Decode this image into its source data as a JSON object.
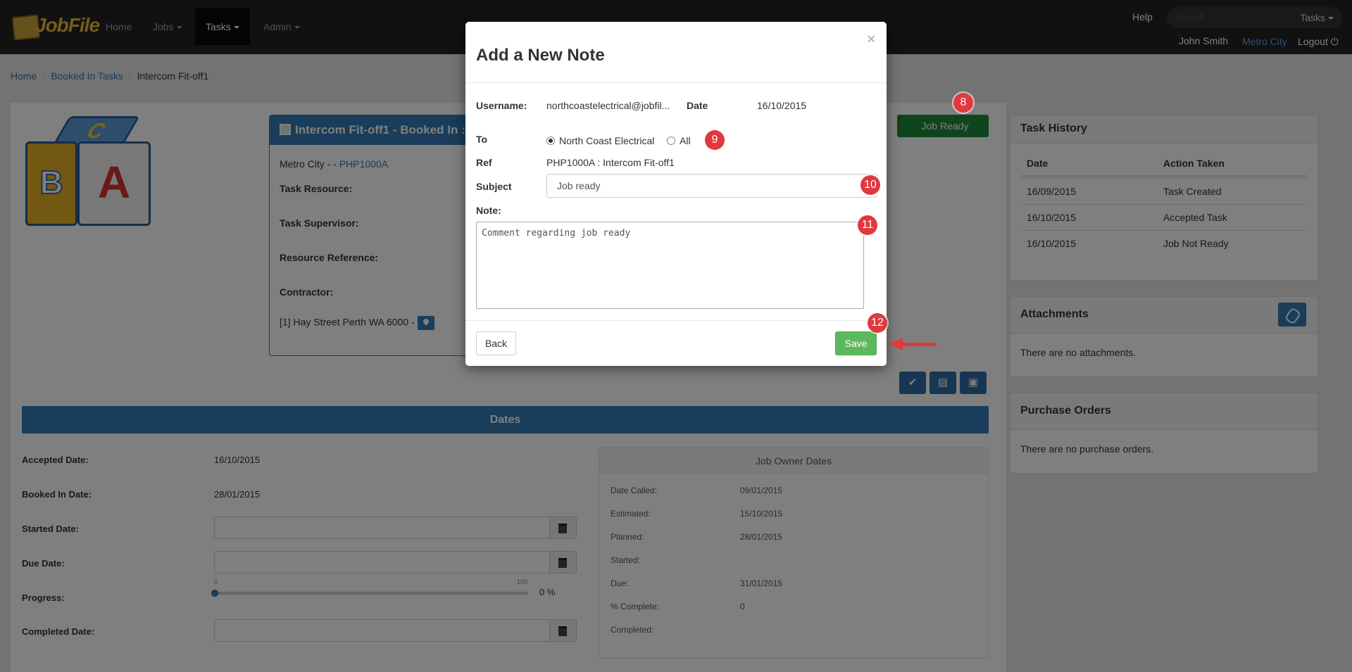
{
  "nav": {
    "logo_text": "JobFile",
    "items": [
      {
        "label": "Home"
      },
      {
        "label": "Jobs"
      },
      {
        "label": "Tasks"
      },
      {
        "label": "Admin"
      }
    ],
    "help": "Help",
    "search_placeholder": "Search",
    "search_scope": "Tasks",
    "user": "John Smith",
    "city": "Metro City",
    "logout": "Logout"
  },
  "breadcrumb": {
    "home": "Home",
    "booked": "Booked In Tasks",
    "current": "Intercom Fit-off1"
  },
  "task": {
    "title": "Intercom Fit-off1 - Booked In : ",
    "location_prefix": "Metro City - - ",
    "location_link": "PHP1000A",
    "resource_label": "Task Resource:",
    "supervisor_label": "Task Supervisor:",
    "resource_ref_label": "Resource Reference:",
    "contractor_label": "Contractor:",
    "address": "[1] Hay Street Perth WA 6000 - "
  },
  "job_ready_button": "Job Ready",
  "dates": {
    "title": "Dates",
    "accepted_label": "Accepted Date:",
    "accepted_value": "16/10/2015",
    "booked_label": "Booked In Date:",
    "booked_value": "28/01/2015",
    "started_label": "Started Date:",
    "due_label": "Due Date:",
    "progress_label": "Progress:",
    "progress_min": "0",
    "progress_max": "100",
    "progress_value": "0 %",
    "progress_fraction": 0,
    "completed_label": "Completed Date:"
  },
  "job_owner_dates": {
    "title": "Job Owner Dates",
    "rows": [
      {
        "label": "Date Called:",
        "value": "09/01/2015"
      },
      {
        "label": "Estimated:",
        "value": "15/10/2015"
      },
      {
        "label": "Planned:",
        "value": "28/01/2015"
      },
      {
        "label": "Started:",
        "value": ""
      },
      {
        "label": "Due:",
        "value": "31/01/2015"
      },
      {
        "label": "% Complete:",
        "value": "0"
      },
      {
        "label": "Completed:",
        "value": ""
      }
    ]
  },
  "task_history": {
    "title": "Task History",
    "col_date": "Date",
    "col_action": "Action Taken",
    "rows": [
      {
        "date": "16/09/2015",
        "action": "Task Created"
      },
      {
        "date": "16/10/2015",
        "action": "Accepted Task"
      },
      {
        "date": "16/10/2015",
        "action": "Job Not Ready"
      }
    ]
  },
  "attachments": {
    "title": "Attachments",
    "empty": "There are no attachments."
  },
  "purchase_orders": {
    "title": "Purchase Orders",
    "empty": "There are no purchase orders."
  },
  "modal": {
    "title": "Add a New Note",
    "close": "×",
    "username_label": "Username:",
    "username_value": "northcoastelectrical@jobfil...",
    "date_label": "Date",
    "date_value": "16/10/2015",
    "to_label": "To",
    "to_option_1": "North Coast Electrical",
    "to_option_2": "All",
    "ref_label": "Ref",
    "ref_value": "PHP1000A : Intercom Fit-off1",
    "subject_label": "Subject",
    "subject_value": "Job ready",
    "note_label": "Note:",
    "note_value": "Comment regarding job ready",
    "back": "Back",
    "save": "Save"
  },
  "badges": {
    "b8": "8",
    "b9": "9",
    "b10": "10",
    "b11": "11",
    "b12": "12"
  },
  "colors": {
    "accent": "#337ab7",
    "save": "#5cb85c",
    "job_ready": "#1e8a3a",
    "badge": "#e0393e"
  }
}
